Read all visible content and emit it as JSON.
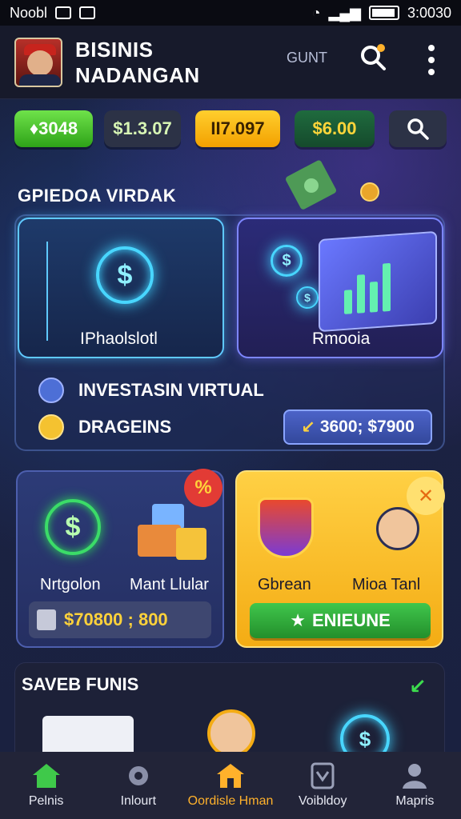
{
  "status_bar": {
    "carrier": "Noobl",
    "time": "3:0030"
  },
  "header": {
    "title_line1": "BISINIS",
    "title_line2": "NADANGAN",
    "guest_label": "GUNT"
  },
  "currency_chips": [
    {
      "label": "♦3048"
    },
    {
      "label": "$1.3.07"
    },
    {
      "label": "II7.097"
    },
    {
      "label": "$6.00"
    }
  ],
  "section1": {
    "title": "GPIEDOA VIRDAK",
    "card_left_label": "IPhaolslotl",
    "card_right_label": "Rmooia",
    "row1_label": "INVESTASIN VIRTUAL",
    "row2_label": "DRAGEINS",
    "range_value": "3600; $7900"
  },
  "section2": {
    "left_card": {
      "label_left": "Nrtgolon",
      "label_right": "Mant Llular",
      "pill_value": "$70800 ; 800",
      "corner": "%"
    },
    "right_card": {
      "label_left": "Gbrean",
      "label_right": "Mioa Tanl",
      "button_label": "ENIEUNE",
      "corner": "✕"
    }
  },
  "saved": {
    "title": "SAVEB FUNIS"
  },
  "bottom_nav": [
    {
      "label": "Pelnis",
      "icon": "home-icon"
    },
    {
      "label": "Inlourt",
      "icon": "gear-icon"
    },
    {
      "label": "Oordisle Hman",
      "icon": "house-icon"
    },
    {
      "label": "Voibldoy",
      "icon": "shield-icon"
    },
    {
      "label": "Mapris",
      "icon": "user-icon"
    }
  ],
  "colors": {
    "accent": "#ffb12b",
    "green": "#2ea318",
    "gold": "#f4ac14"
  }
}
